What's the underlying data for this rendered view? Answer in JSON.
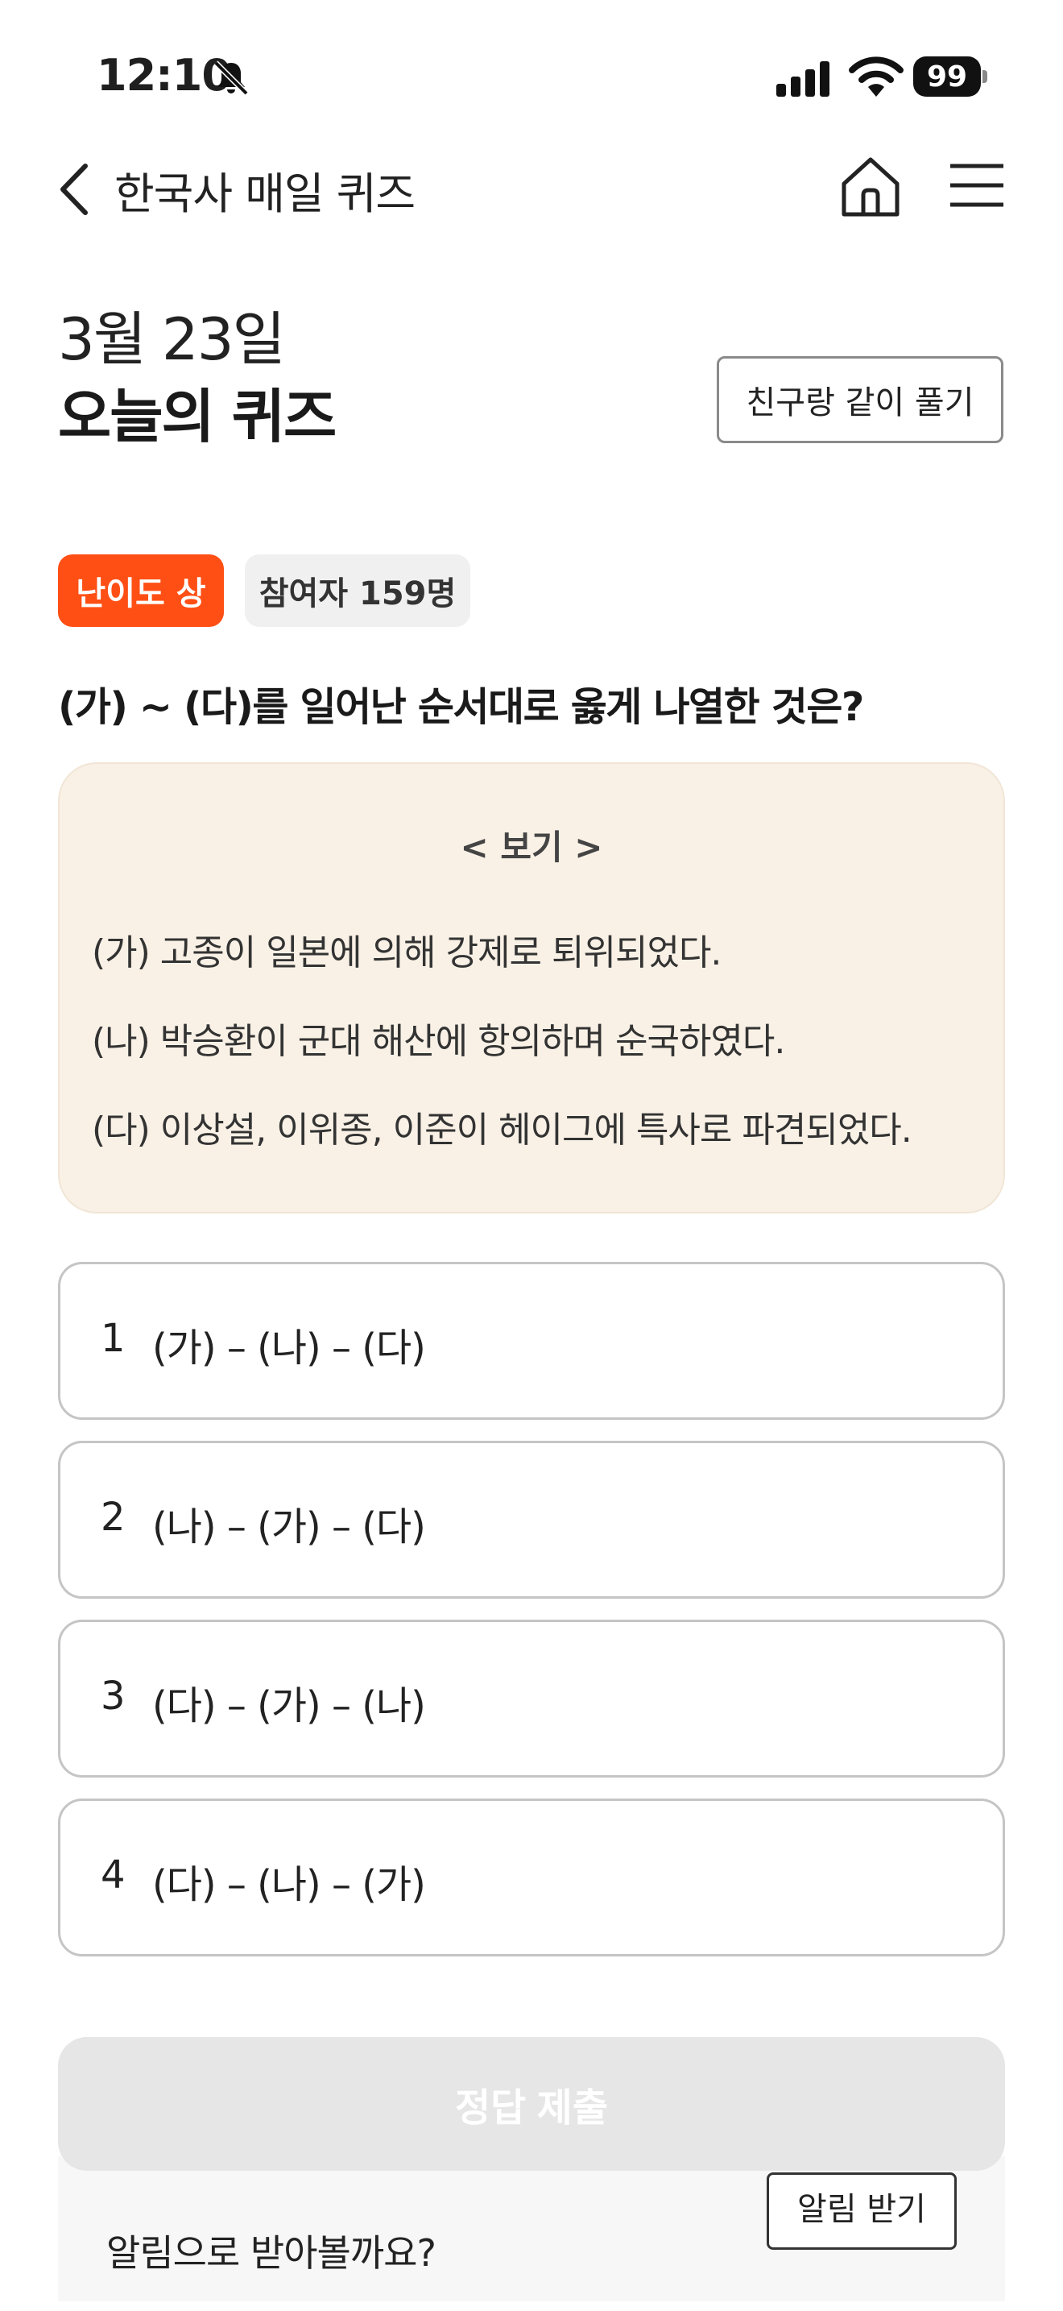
{
  "status_bar": {
    "time": "12:10",
    "battery": "99"
  },
  "nav": {
    "title": "한국사 매일 퀴즈"
  },
  "header": {
    "date": "3월 23일",
    "title": "오늘의 퀴즈",
    "friend_button": "친구랑 같이 풀기"
  },
  "badges": {
    "difficulty": "난이도 상",
    "participants": "참여자 159명"
  },
  "question": "(가) ~ (다)를 일어난 순서대로 옳게 나열한 것은?",
  "example": {
    "heading": "< 보기 >",
    "items": [
      "(가) 고종이 일본에 의해 강제로 퇴위되었다.",
      "(나) 박승환이 군대 해산에 항의하며 순국하였다.",
      "(다) 이상설, 이위종, 이준이 헤이그에 특사로 파견되었다."
    ]
  },
  "options": [
    {
      "number": "1",
      "text": "(가) – (나) – (다)"
    },
    {
      "number": "2",
      "text": "(나) – (가) – (다)"
    },
    {
      "number": "3",
      "text": "(다) – (가) – (나)"
    },
    {
      "number": "4",
      "text": "(다) – (나) – (가)"
    }
  ],
  "submit_button": "정답 제출",
  "banner": {
    "text": "알림으로 받아볼까요?",
    "button": "알림 받기"
  }
}
